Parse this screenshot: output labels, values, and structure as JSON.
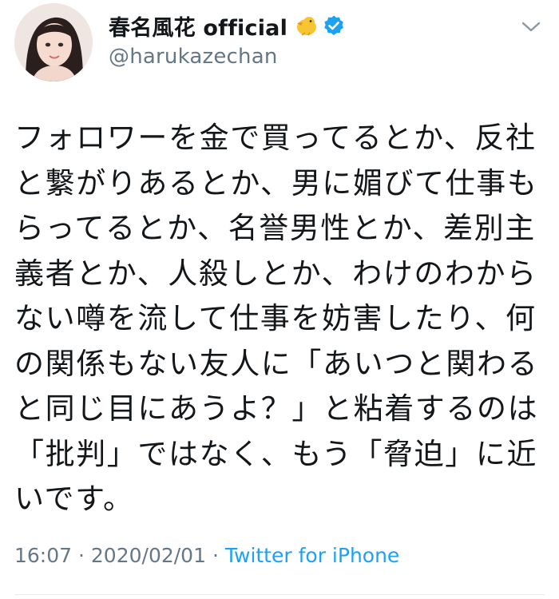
{
  "tweet": {
    "display_name": "春名風花 official",
    "handle": "@harukazechan",
    "verified": true,
    "name_emoji": "chick-emoji",
    "body_lines": [
      "フォロワーを金で買ってるとか、反社",
      "と繋がりあるとか、男に媚びて仕事も",
      "らってるとか、名誉男性とか、差別主",
      "義者とか、人殺しとか、わけのわから",
      "ない噂を流して仕事を妨害したり、何",
      "の関係もない友人に「あいつと関わる",
      "と同じ目にあうよ？」と粘着するのは",
      "「批判」ではなく、もう「脅迫」に近",
      "いです。"
    ],
    "time": "16:07",
    "separator": "·",
    "date": "2020/02/01",
    "source": "Twitter for iPhone"
  },
  "colors": {
    "text": "#14171a",
    "secondary": "#657786",
    "link": "#1da1f2"
  }
}
